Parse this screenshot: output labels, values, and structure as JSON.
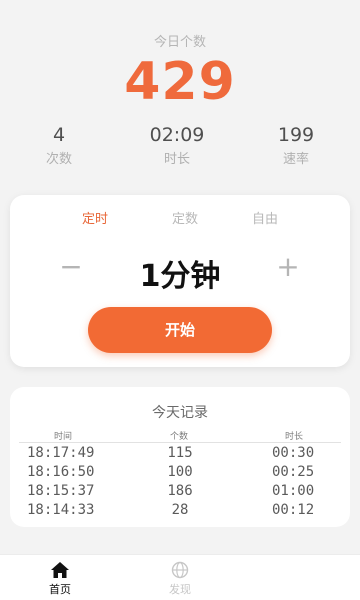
{
  "stats": {
    "today_label": "今日个数",
    "today_count": "429",
    "metrics": [
      {
        "value": "4",
        "label": "次数"
      },
      {
        "value": "02:09",
        "label": "时长"
      },
      {
        "value": "199",
        "label": "速率"
      }
    ]
  },
  "timer": {
    "tabs": [
      "定时",
      "定数",
      "自由"
    ],
    "active_tab": "定时",
    "minus": "−",
    "plus": "+",
    "duration": "1分钟",
    "start_label": "开始"
  },
  "records": {
    "title": "今天记录",
    "headers": [
      "时间",
      "个数",
      "时长"
    ],
    "rows": [
      [
        "18:17:49",
        "115",
        "00:30"
      ],
      [
        "18:16:50",
        "100",
        "00:25"
      ],
      [
        "18:15:37",
        "186",
        "01:00"
      ],
      [
        "18:14:33",
        "28",
        "00:12"
      ]
    ]
  },
  "tabbar": {
    "items": [
      {
        "label": "首页",
        "icon": "home-icon"
      },
      {
        "label": "发现",
        "icon": "globe-icon"
      }
    ]
  },
  "colors": {
    "accent": "#ef6a3c",
    "button": "#f26a34",
    "background": "#f3f3f3"
  }
}
